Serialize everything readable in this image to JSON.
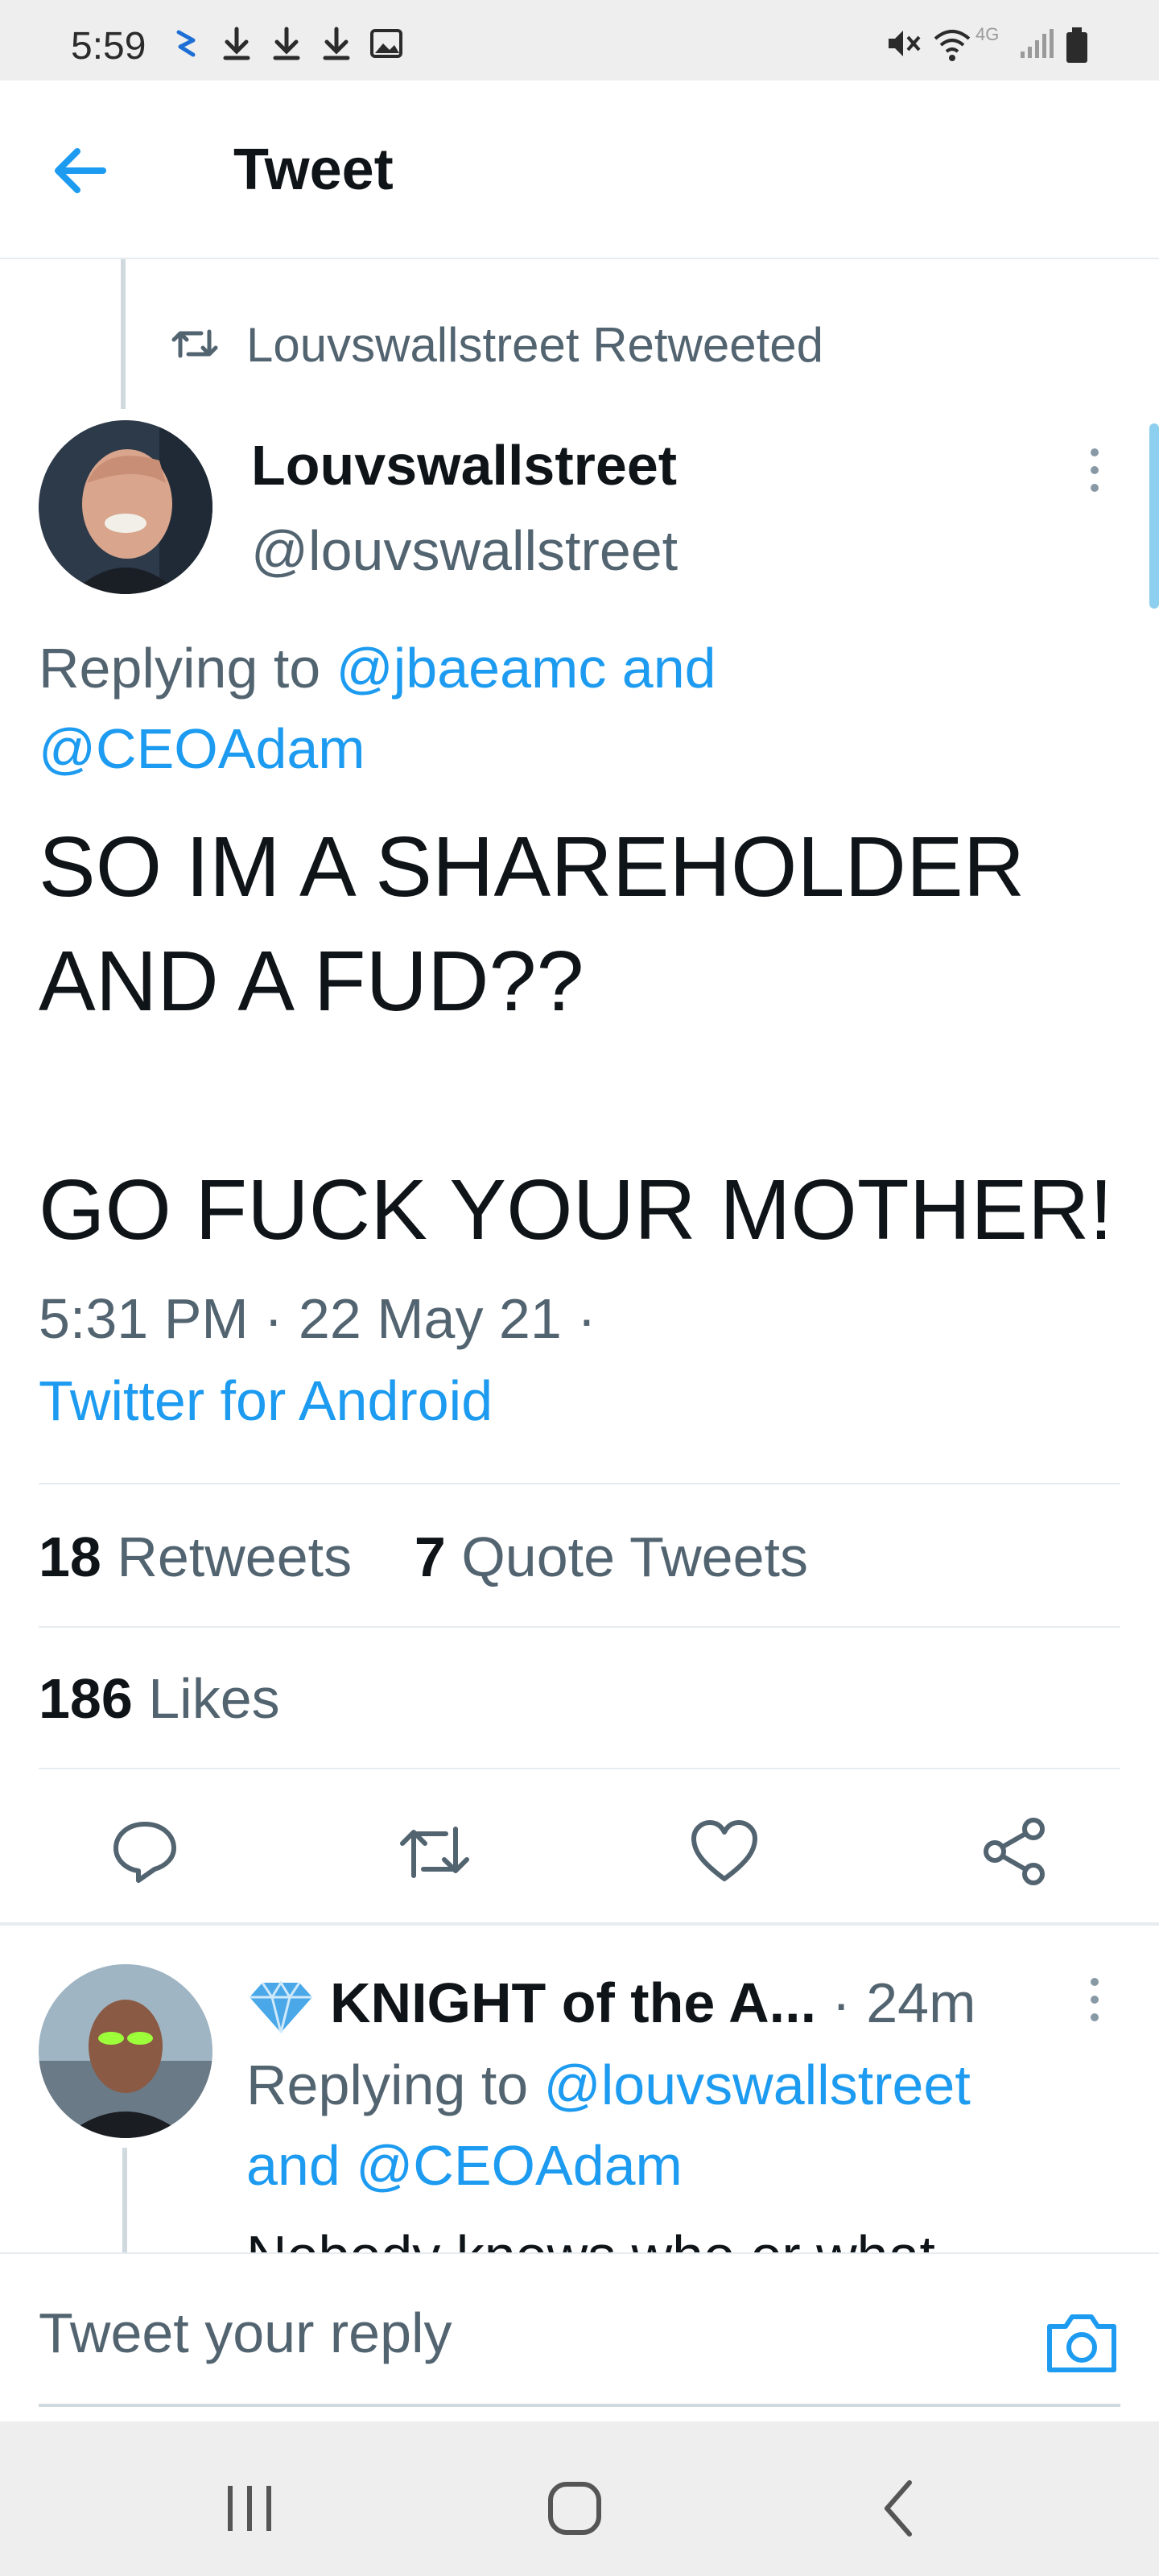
{
  "status_bar": {
    "time": "5:59",
    "network": "4G"
  },
  "header": {
    "title": "Tweet"
  },
  "tweet": {
    "retweet_context": "Louvswallstreet Retweeted",
    "author_name": "Louvswallstreet",
    "author_handle": "@louvswallstreet",
    "replying_prefix": "Replying to",
    "replying_mentions_1": "@jbaeamc and",
    "replying_mentions_2": "@CEOAdam",
    "body_lines": [
      "SO IM A SHAREHOLDER",
      "AND A FUD??",
      "",
      "GO FUCK YOUR MOTHER!"
    ],
    "timestamp": "5:31 PM · 22 May 21 ·",
    "source": "Twitter for Android",
    "retweets_count": "18",
    "retweets_label": "Retweets",
    "quotes_count": "7",
    "quotes_label": "Quote Tweets",
    "likes_count": "186",
    "likes_label": "Likes"
  },
  "reply": {
    "name": "KNIGHT of the A...",
    "time": "· 24m",
    "replying_prefix": "Replying to",
    "mention_1": "@louvswallstreet",
    "and_word": "and",
    "mention_2": "@CEOAdam",
    "body_cut": "Nobody knows who or what"
  },
  "composer": {
    "placeholder": "Tweet your reply"
  },
  "colors": {
    "accent": "#1d9bf0",
    "secondary_text": "#536471",
    "divider": "#e6ecf0"
  },
  "icons": {
    "back": "arrow-left-icon",
    "retweet": "retweet-icon",
    "more": "more-vertical-icon",
    "reply": "reply-icon",
    "like": "heart-icon",
    "share": "share-icon",
    "camera": "camera-icon",
    "gem": "gem-icon"
  }
}
